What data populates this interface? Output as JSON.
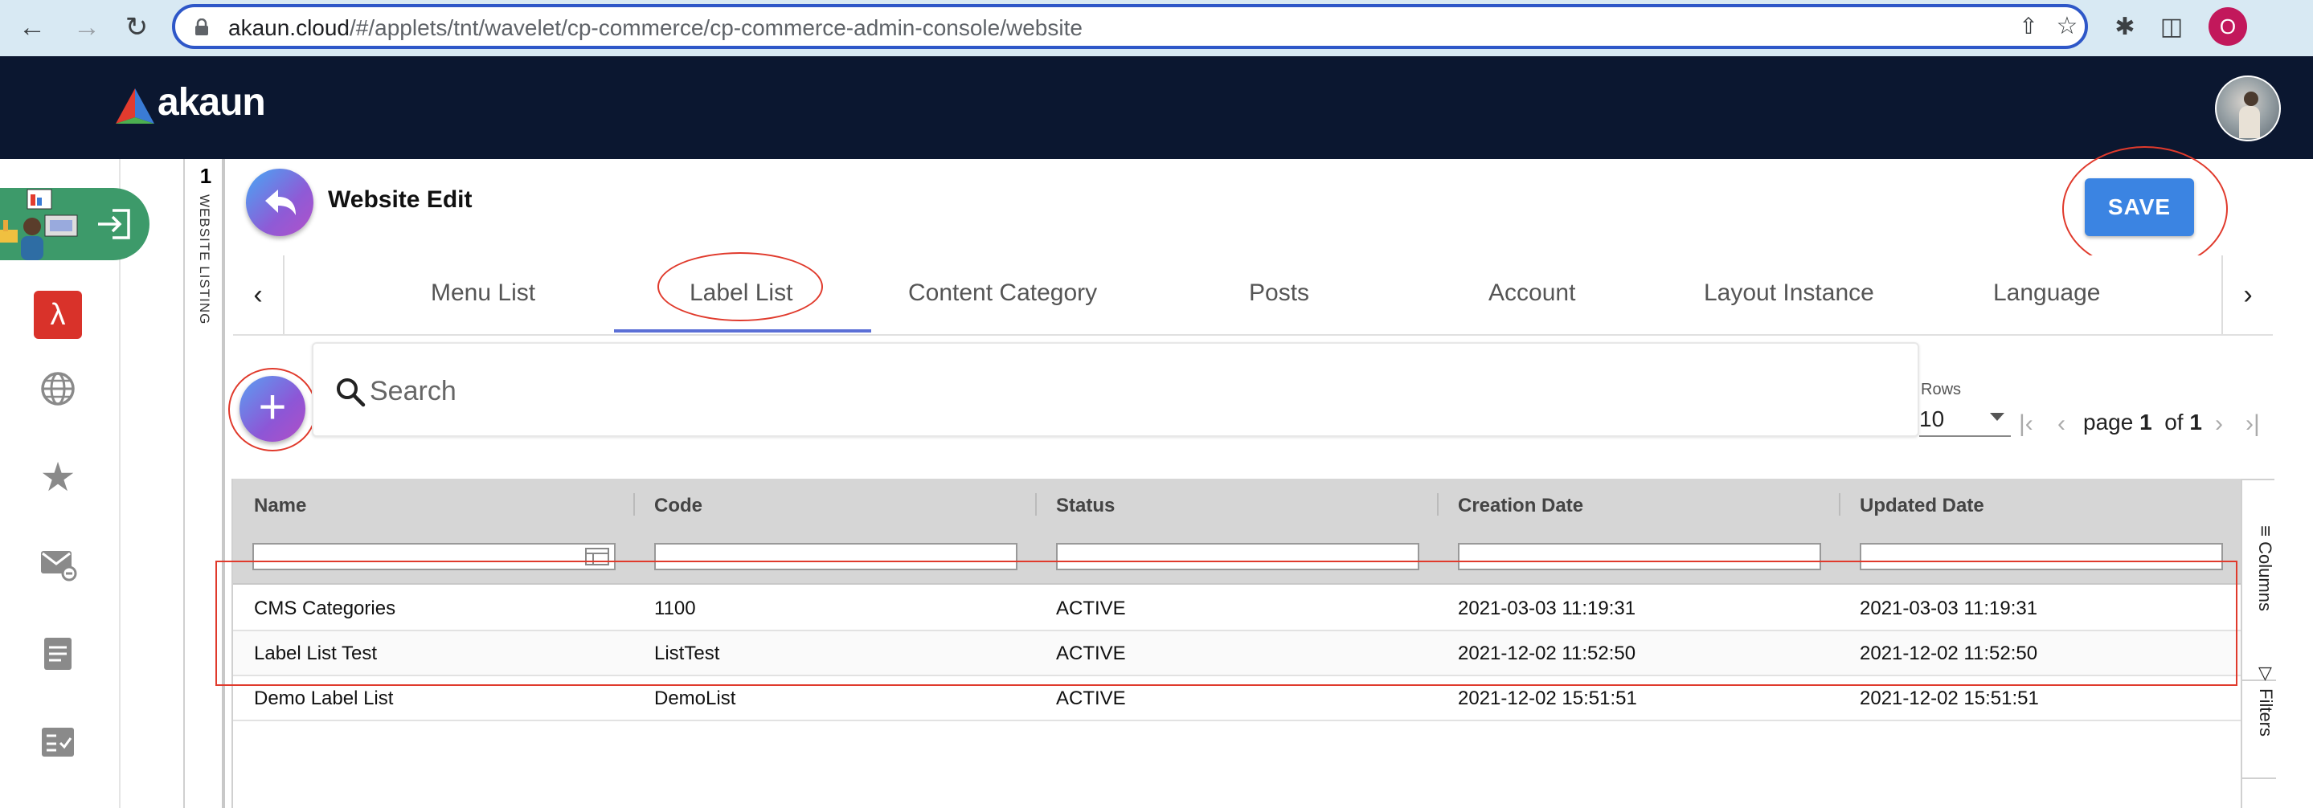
{
  "browser": {
    "url_host": "akaun.cloud",
    "url_path": "/#/applets/tnt/wavelet/cp-commerce/cp-commerce-admin-console/website",
    "profile_initial": "O"
  },
  "app": {
    "logo_text": "akaun"
  },
  "listing_strip": {
    "number": "1",
    "label": "WEBSITE LISTING"
  },
  "page": {
    "title": "Website Edit",
    "save_label": "SAVE"
  },
  "tabs": [
    {
      "label": "Menu List"
    },
    {
      "label": "Label List"
    },
    {
      "label": "Content Category"
    },
    {
      "label": "Posts"
    },
    {
      "label": "Account"
    },
    {
      "label": "Layout Instance"
    },
    {
      "label": "Language"
    }
  ],
  "active_tab": "Label List",
  "search": {
    "placeholder": "Search"
  },
  "pagination": {
    "rows_label": "Rows",
    "rows_value": "10",
    "page_word": "page",
    "page": "1",
    "of_word": "of",
    "total": "1"
  },
  "grid": {
    "columns": [
      "Name",
      "Code",
      "Status",
      "Creation Date",
      "Updated Date"
    ],
    "rows": [
      [
        "CMS Categories",
        "1100",
        "ACTIVE",
        "2021-03-03 11:19:31",
        "2021-03-03 11:19:31"
      ],
      [
        "Label List Test",
        "ListTest",
        "ACTIVE",
        "2021-12-02 11:52:50",
        "2021-12-02 11:52:50"
      ],
      [
        "Demo Label List",
        "DemoList",
        "ACTIVE",
        "2021-12-02 15:51:51",
        "2021-12-02 15:51:51"
      ]
    ],
    "side_tabs": [
      "Columns",
      "Filters"
    ]
  },
  "icons": {
    "back": "back-arrow-icon",
    "add": "plus-icon",
    "search": "search-icon",
    "rail": [
      "login-icon",
      "pdf-icon",
      "globe-icon",
      "star-icon",
      "mail-icon",
      "document-icon",
      "checklist-icon"
    ]
  },
  "colors": {
    "header_bg": "#0b1730",
    "save_button": "#3b84e2",
    "tab_underline": "#5b6fd6",
    "annotation": "#e03a2c",
    "launcher": "#3d9a6a"
  }
}
